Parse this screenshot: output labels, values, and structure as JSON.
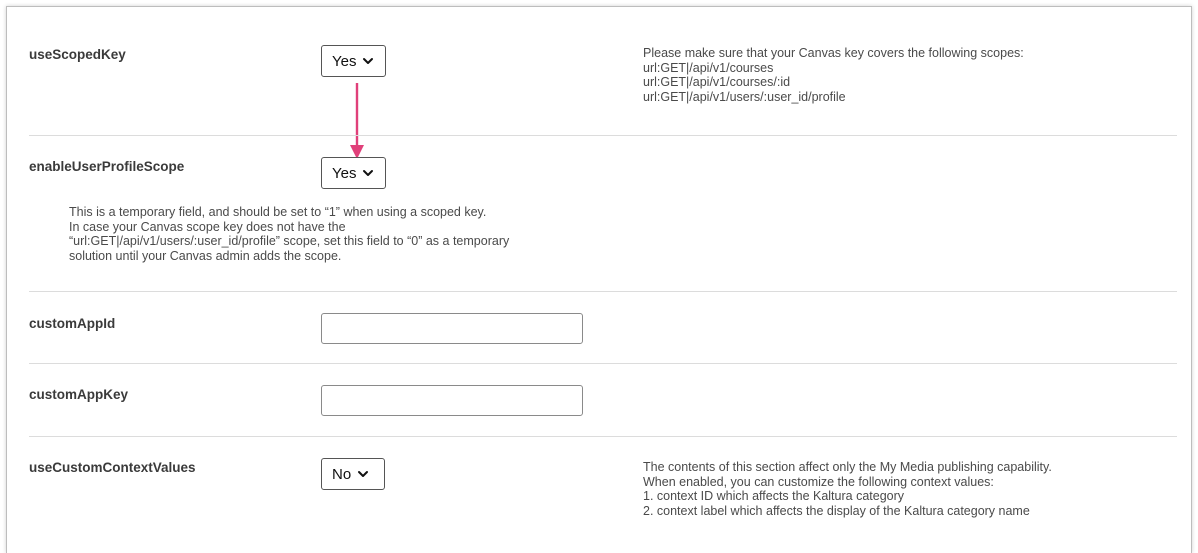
{
  "settings": {
    "useScopedKey": {
      "label": "useScopedKey",
      "value": "Yes",
      "help": [
        "Please make sure that your Canvas key covers the following scopes:",
        "url:GET|/api/v1/courses",
        "url:GET|/api/v1/courses/:id",
        "url:GET|/api/v1/users/:user_id/profile"
      ]
    },
    "enableUserProfileScope": {
      "label": "enableUserProfileScope",
      "value": "Yes",
      "help": [
        "This is a temporary field, and should be set to “1” when using a scoped key.",
        "In case your Canvas scope key does not have the",
        "“url:GET|/api/v1/users/:user_id/profile” scope, set this field to “0” as a temporary",
        "solution until your Canvas admin adds the scope."
      ]
    },
    "customAppId": {
      "label": "customAppId",
      "value": ""
    },
    "customAppKey": {
      "label": "customAppKey",
      "value": ""
    },
    "useCustomContextValues": {
      "label": "useCustomContextValues",
      "value": "No",
      "help": [
        "The contents of this section affect only the My Media publishing capability.",
        "When enabled, you can customize the following context values:",
        "1. context ID which affects the Kaltura category",
        "2. context label which affects the display of the Kaltura category name"
      ]
    }
  },
  "annotation": {
    "arrow_color": "#e0407a",
    "arrow_icon": "arrow-down-icon"
  },
  "colors": {
    "divider": "#dcdcdc",
    "label": "#3a3a3a",
    "help_text": "#4a4a4a"
  }
}
